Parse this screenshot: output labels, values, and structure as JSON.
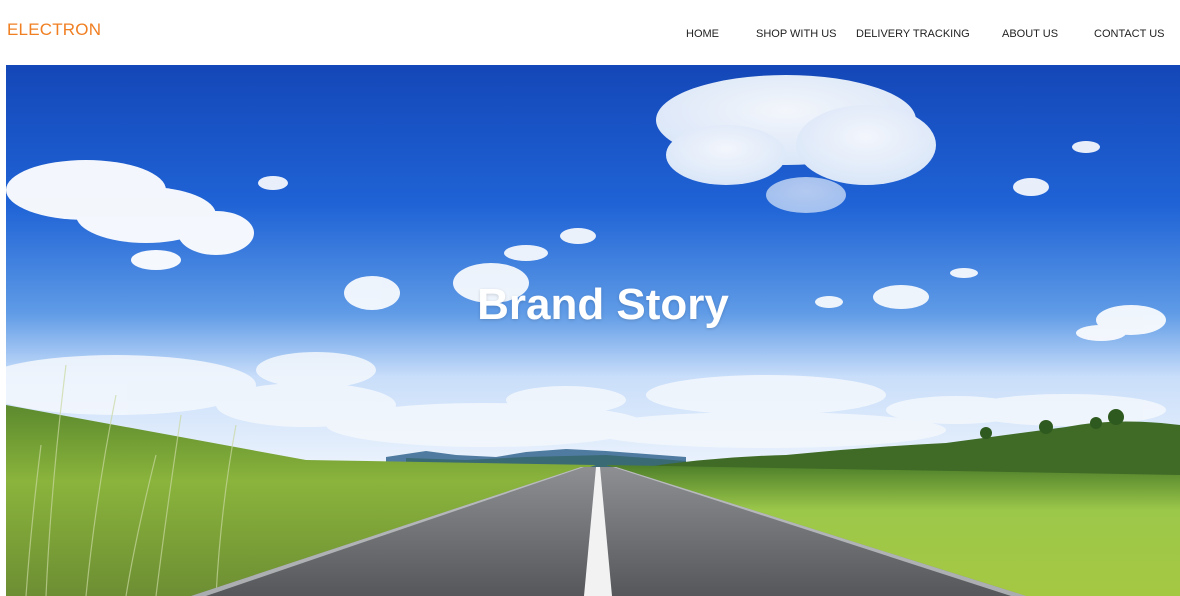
{
  "header": {
    "logo": "ELECTRON",
    "nav": {
      "home": "HOME",
      "shop": "SHOP WITH US",
      "delivery": "DELIVERY TRACKING",
      "about": "ABOUT US",
      "contact": "CONTACT US"
    }
  },
  "hero": {
    "title": "Brand Story",
    "image": "open-road-sky-image"
  },
  "colors": {
    "brand": "#f07f22",
    "nav_text": "#222222",
    "sky": "#1f5fd0",
    "grass": "#7fb437",
    "road": "#6b6d71"
  }
}
